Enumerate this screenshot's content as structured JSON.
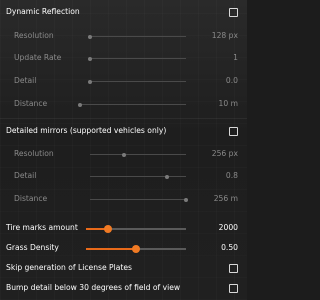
{
  "accent_color": "#e86a1a",
  "dynamic_reflection": {
    "label": "Dynamic Reflection",
    "checked": false,
    "settings": [
      {
        "label": "Resolution",
        "value": "128 px",
        "level": 0.0
      },
      {
        "label": "Update Rate",
        "value": "1",
        "level": 0.0
      },
      {
        "label": "Detail",
        "value": "0.0",
        "level": 0.0
      },
      {
        "label": "Distance",
        "value": "10 m",
        "level": 0.0
      }
    ]
  },
  "detailed_mirrors": {
    "label": "Detailed mirrors (supported vehicles only)",
    "checked": false,
    "settings": [
      {
        "label": "Resolution",
        "value": "256 px",
        "level": 0.35
      },
      {
        "label": "Detail",
        "value": "0.8",
        "level": 0.8
      },
      {
        "label": "Distance",
        "value": "256 m",
        "level": 1.0
      }
    ]
  },
  "tire_marks": {
    "label": "Tire marks amount",
    "value": "2000",
    "level": 0.2
  },
  "grass_density": {
    "label": "Grass Density",
    "value": "0.50",
    "level": 0.5
  },
  "skip_license_plates": {
    "label": "Skip generation of License Plates",
    "checked": false
  },
  "bump_detail": {
    "label": "Bump detail below 30 degrees of field of view",
    "checked": false
  }
}
